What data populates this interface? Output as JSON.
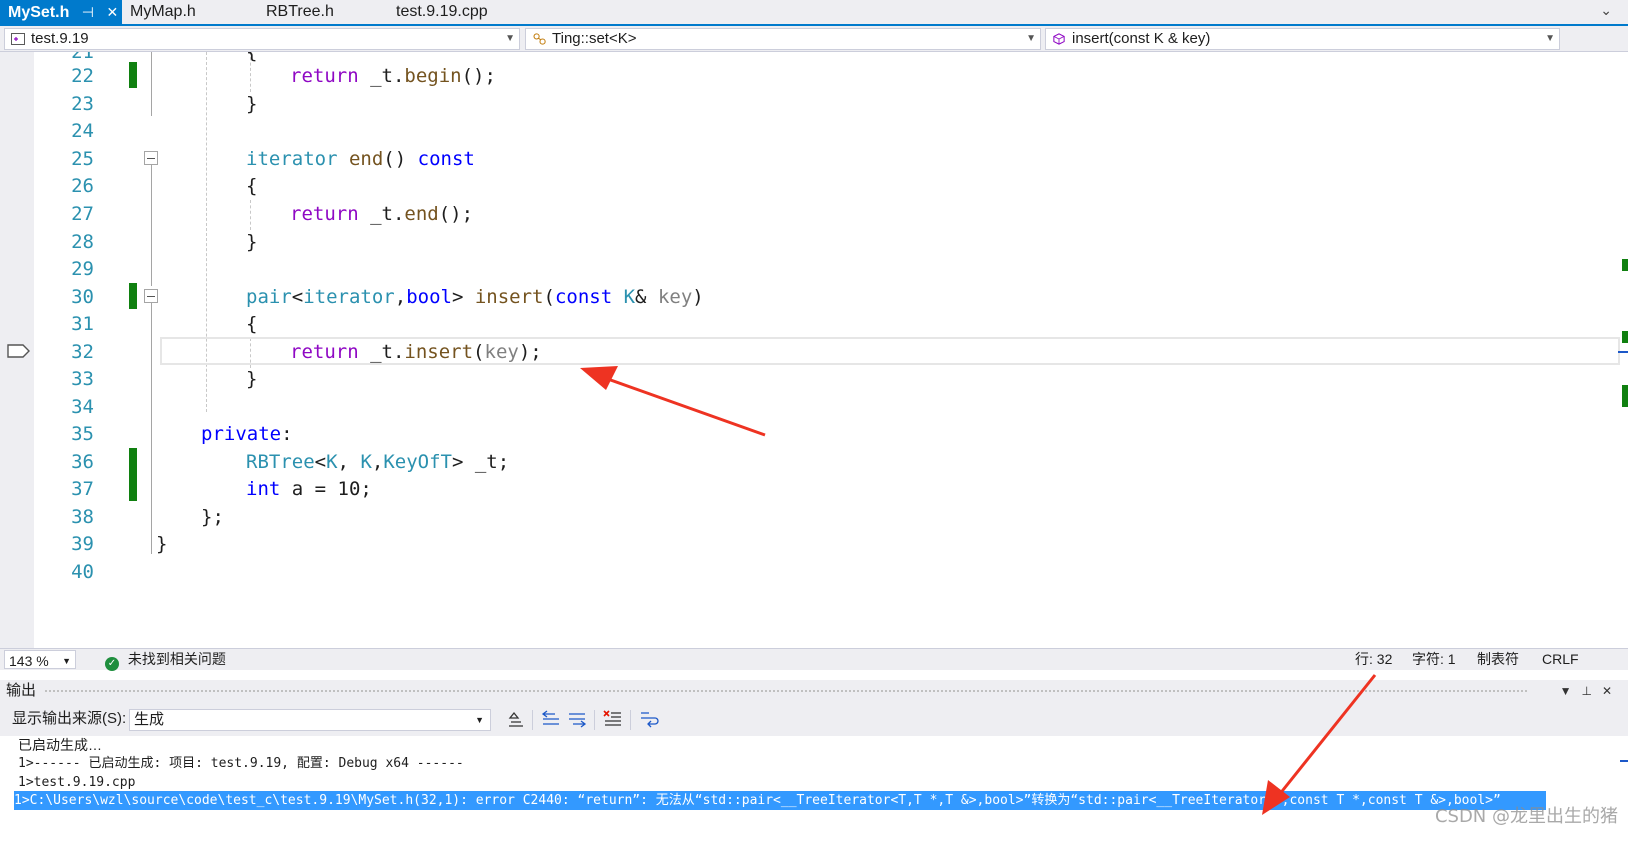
{
  "tabs": [
    {
      "label": "MySet.h",
      "active": true,
      "pin": "⊣",
      "close": "✕"
    },
    {
      "label": "MyMap.h",
      "active": false
    },
    {
      "label": "RBTree.h",
      "active": false
    },
    {
      "label": "test.9.19.cpp",
      "active": false
    }
  ],
  "navbar": {
    "project": "test.9.19",
    "scope": "Ting::set<K>",
    "member": "insert(const K & key)"
  },
  "editor": {
    "line_numbers": [
      "21",
      "22",
      "23",
      "24",
      "25",
      "26",
      "27",
      "28",
      "29",
      "30",
      "31",
      "32",
      "33",
      "34",
      "35",
      "36",
      "37",
      "38",
      "39",
      "40"
    ],
    "current_line": "32"
  },
  "status": {
    "zoom": "143 %",
    "issues": "未找到相关问题",
    "line": "行: 32",
    "char": "字符: 1",
    "tabs": "制表符",
    "eol": "CRLF"
  },
  "output": {
    "title": "输出",
    "source_label": "显示输出来源(S):",
    "source_value": "生成",
    "lines": [
      "已启动生成…",
      "1>------ 已启动生成: 项目: test.9.19, 配置: Debug x64 ------",
      "1>test.9.19.cpp",
      "1>C:\\Users\\wzl\\source\\code\\test_c\\test.9.19\\MySet.h(32,1): error C2440: “return”: 无法从“std::pair<__TreeIterator<T,T *,T &>,bool>”转换为“std::pair<__TreeIterator<T,const T *,const T &>,bool>”"
    ]
  },
  "watermark": "CSDN @龙里出生的猪",
  "colors": {
    "accent": "#007acc",
    "change_marker": "#108010",
    "error_highlight": "#3399ff",
    "annotation_arrow": "#ee3322"
  }
}
